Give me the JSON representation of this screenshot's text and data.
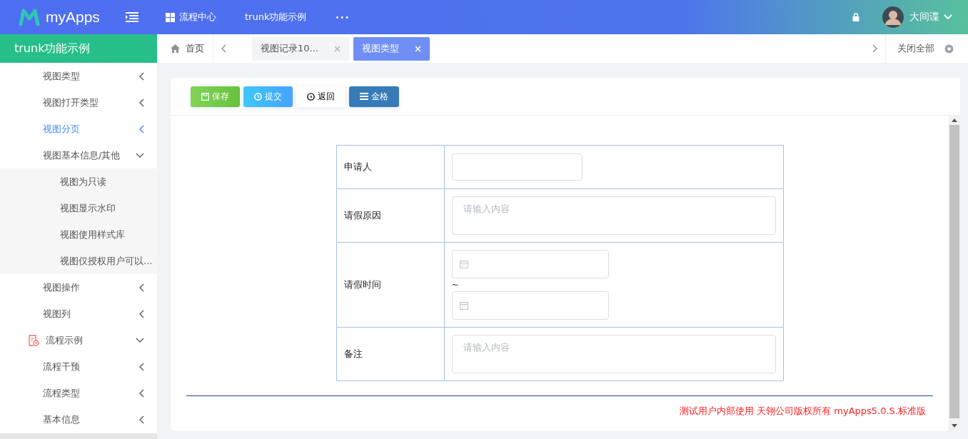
{
  "header": {
    "logo_text": "myApps",
    "nav": [
      {
        "label": "流程中心",
        "kind": "grid"
      },
      {
        "label": "trunk功能示例",
        "kind": "plain"
      },
      {
        "label": "•••",
        "kind": "more"
      }
    ],
    "user": "大间谍"
  },
  "sidebar": {
    "title": "trunk功能示例",
    "items": [
      {
        "label": "视图类型",
        "kind": "item",
        "expanded": false,
        "selected": false
      },
      {
        "label": "视图打开类型",
        "kind": "item",
        "expanded": false,
        "selected": false
      },
      {
        "label": "视图分页",
        "kind": "item",
        "expanded": false,
        "selected": true
      },
      {
        "label": "视图基本信息/其他",
        "kind": "item",
        "expanded": true,
        "selected": false,
        "children": [
          {
            "label": "视图为只读"
          },
          {
            "label": "视图显示水印"
          },
          {
            "label": "视图使用样式库"
          },
          {
            "label": "视图仅授权用户可以..."
          }
        ]
      },
      {
        "label": "视图操作",
        "kind": "item",
        "expanded": false,
        "selected": false
      },
      {
        "label": "视图列",
        "kind": "item",
        "expanded": false,
        "selected": false
      },
      {
        "label": "流程示例",
        "kind": "group",
        "expanded": true,
        "selected": false
      },
      {
        "label": "流程干预",
        "kind": "item",
        "expanded": false,
        "selected": false
      },
      {
        "label": "流程类型",
        "kind": "item",
        "expanded": false,
        "selected": false
      },
      {
        "label": "基本信息",
        "kind": "item",
        "expanded": false,
        "selected": false
      }
    ]
  },
  "tabs": {
    "home": "首页",
    "items": [
      {
        "label": "视图记录10...",
        "selected": false
      },
      {
        "label": "视图类型",
        "selected": true
      }
    ],
    "close_all": "关闭全部"
  },
  "toolbar": [
    {
      "label": "保存",
      "kind": "save"
    },
    {
      "label": "提交",
      "kind": "submit"
    },
    {
      "label": "返回",
      "kind": "back"
    },
    {
      "label": "金格",
      "kind": "list"
    }
  ],
  "form": [
    {
      "label": "申请人",
      "kind": "text"
    },
    {
      "label": "请假原因",
      "kind": "textarea",
      "placeholder": "请输入内容"
    },
    {
      "label": "请假时间",
      "kind": "daterange",
      "separator": "~"
    },
    {
      "label": "备注",
      "kind": "textarea",
      "placeholder": "请输入内容"
    }
  ],
  "footer": "测试用户内部使用 天翎公司版权所有 myApps5.0.S.标准版"
}
